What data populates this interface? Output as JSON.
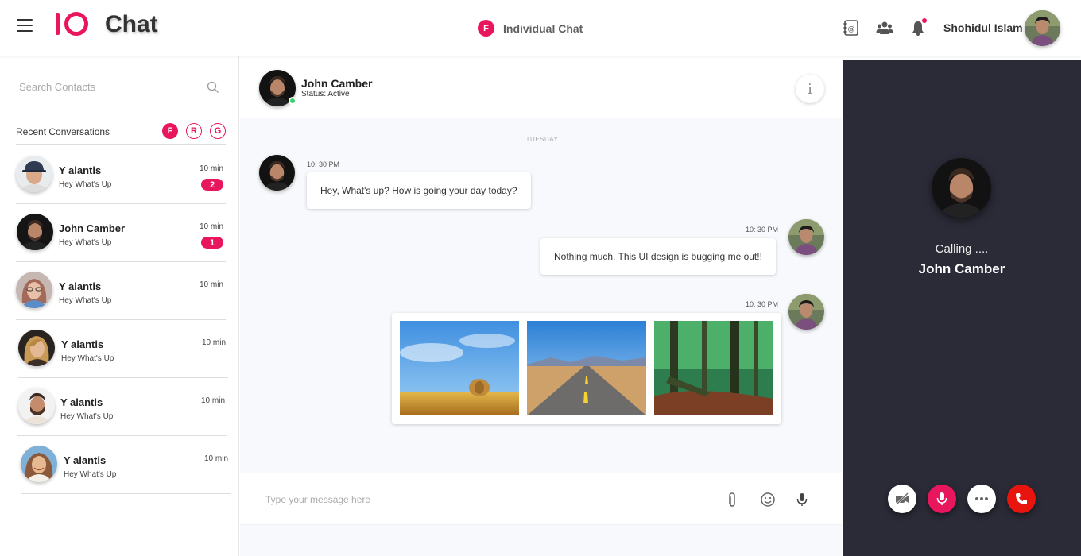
{
  "app": {
    "title": "Chat",
    "center_badge": "F",
    "center_title": "Individual Chat",
    "user_name": "Shohidul Islam",
    "top_icons": [
      "contacts-book-icon",
      "group-icon",
      "bell-icon"
    ],
    "brand_color": "#e8175d"
  },
  "sidebar": {
    "search_placeholder": "Search Contacts",
    "recent_label": "Recent Conversations",
    "filters": [
      "F",
      "R",
      "G"
    ],
    "conversations": [
      {
        "name": "Y alantis",
        "preview": "Hey What's Up",
        "time": "10 min",
        "badge": "2"
      },
      {
        "name": "John Camber",
        "preview": "Hey What's Up",
        "time": "10 min",
        "badge": "1"
      },
      {
        "name": "Y alantis",
        "preview": "Hey What's Up",
        "time": "10 min",
        "badge": ""
      },
      {
        "name": "Y alantis",
        "preview": "Hey What's Up",
        "time": "10 min",
        "badge": ""
      },
      {
        "name": "Y alantis",
        "preview": "Hey What's Up",
        "time": "10 min",
        "badge": ""
      },
      {
        "name": "Y alantis",
        "preview": "Hey What's Up",
        "time": "10 min",
        "badge": ""
      }
    ]
  },
  "chat": {
    "contact_name": "John Camber",
    "status": "Status:  Active",
    "info_label": "i",
    "day_separator": "TUESDAY",
    "messages": [
      {
        "time": "10: 30 PM",
        "text": "Hey, What's up? How is going your day today?"
      },
      {
        "time": "10: 30 PM",
        "text": "Nothing much. This UI design is bugging me out!!"
      },
      {
        "time": "10: 30 PM",
        "text": ""
      }
    ],
    "composer_placeholder": "Type your message here"
  },
  "call": {
    "status": "Calling ....",
    "name": "John Camber",
    "buttons": [
      "video-off-icon",
      "microphone-icon",
      "more-icon",
      "phone-hangup-icon"
    ]
  }
}
